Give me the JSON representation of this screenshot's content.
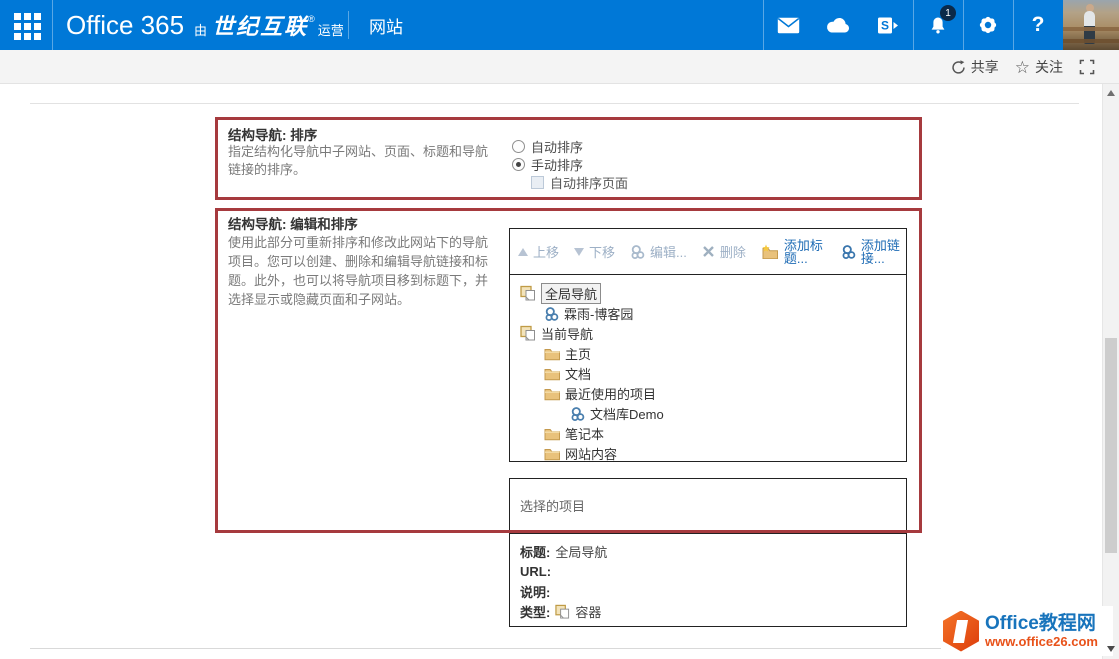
{
  "topbar": {
    "brand": "Office 365",
    "operator_prefix": "由",
    "operator": "世纪互联",
    "operator_mark": "®",
    "operator_suffix": "运营",
    "site_tab": "网站",
    "notification_badge": "1",
    "help_label": "?"
  },
  "actionbar": {
    "share": "共享",
    "follow": "关注"
  },
  "sections": {
    "sort": {
      "title": "结构导航: 排序",
      "description": "指定结构化导航中子网站、页面、标题和导航链接的排序。",
      "options": {
        "auto": "自动排序",
        "manual": "手动排序",
        "auto_pages": "自动排序页面",
        "selected": "手动排序"
      }
    },
    "edit": {
      "title": "结构导航: 编辑和排序",
      "description": "使用此部分可重新排序和修改此网站下的导航项目。您可以创建、删除和编辑导航链接和标题。此外，也可以将导航项目移到标题下，并选择显示或隐藏页面和子网站。",
      "toolbar": {
        "move_up": "上移",
        "move_down": "下移",
        "edit": "编辑...",
        "delete": "删除",
        "add_heading": "添加标题...",
        "add_link": "添加链接..."
      },
      "tree": {
        "items": [
          {
            "label": "全局导航",
            "type": "container",
            "level": 0,
            "selected": true
          },
          {
            "label": "霖雨-博客园",
            "type": "link",
            "level": 1
          },
          {
            "label": "当前导航",
            "type": "container",
            "level": 0
          },
          {
            "label": "主页",
            "type": "folder",
            "level": 1
          },
          {
            "label": "文档",
            "type": "folder",
            "level": 1
          },
          {
            "label": "最近使用的项目",
            "type": "folder",
            "level": 1
          },
          {
            "label": "文档库Demo",
            "type": "link",
            "level": 2
          },
          {
            "label": "笔记本",
            "type": "folder",
            "level": 1
          },
          {
            "label": "网站内容",
            "type": "folder",
            "level": 1
          }
        ]
      },
      "selected_panel": {
        "heading": "选择的项目",
        "fields": [
          {
            "label": "标题:",
            "value": "全局导航"
          },
          {
            "label": "URL:",
            "value": ""
          },
          {
            "label": "说明:",
            "value": ""
          },
          {
            "label": "类型:",
            "value": "容器"
          }
        ]
      }
    }
  },
  "watermark": {
    "title": "Office教程网",
    "url": "www.office26.com"
  },
  "colors": {
    "suite_bar": "#0078d7",
    "annotation_red": "#a63a3e",
    "link_blue": "#1f6cb5",
    "disabled_link": "#9db0c6",
    "watermark_blue": "#1874bc",
    "watermark_orange": "#e8521a",
    "folder_tan": "#e9c27c"
  }
}
